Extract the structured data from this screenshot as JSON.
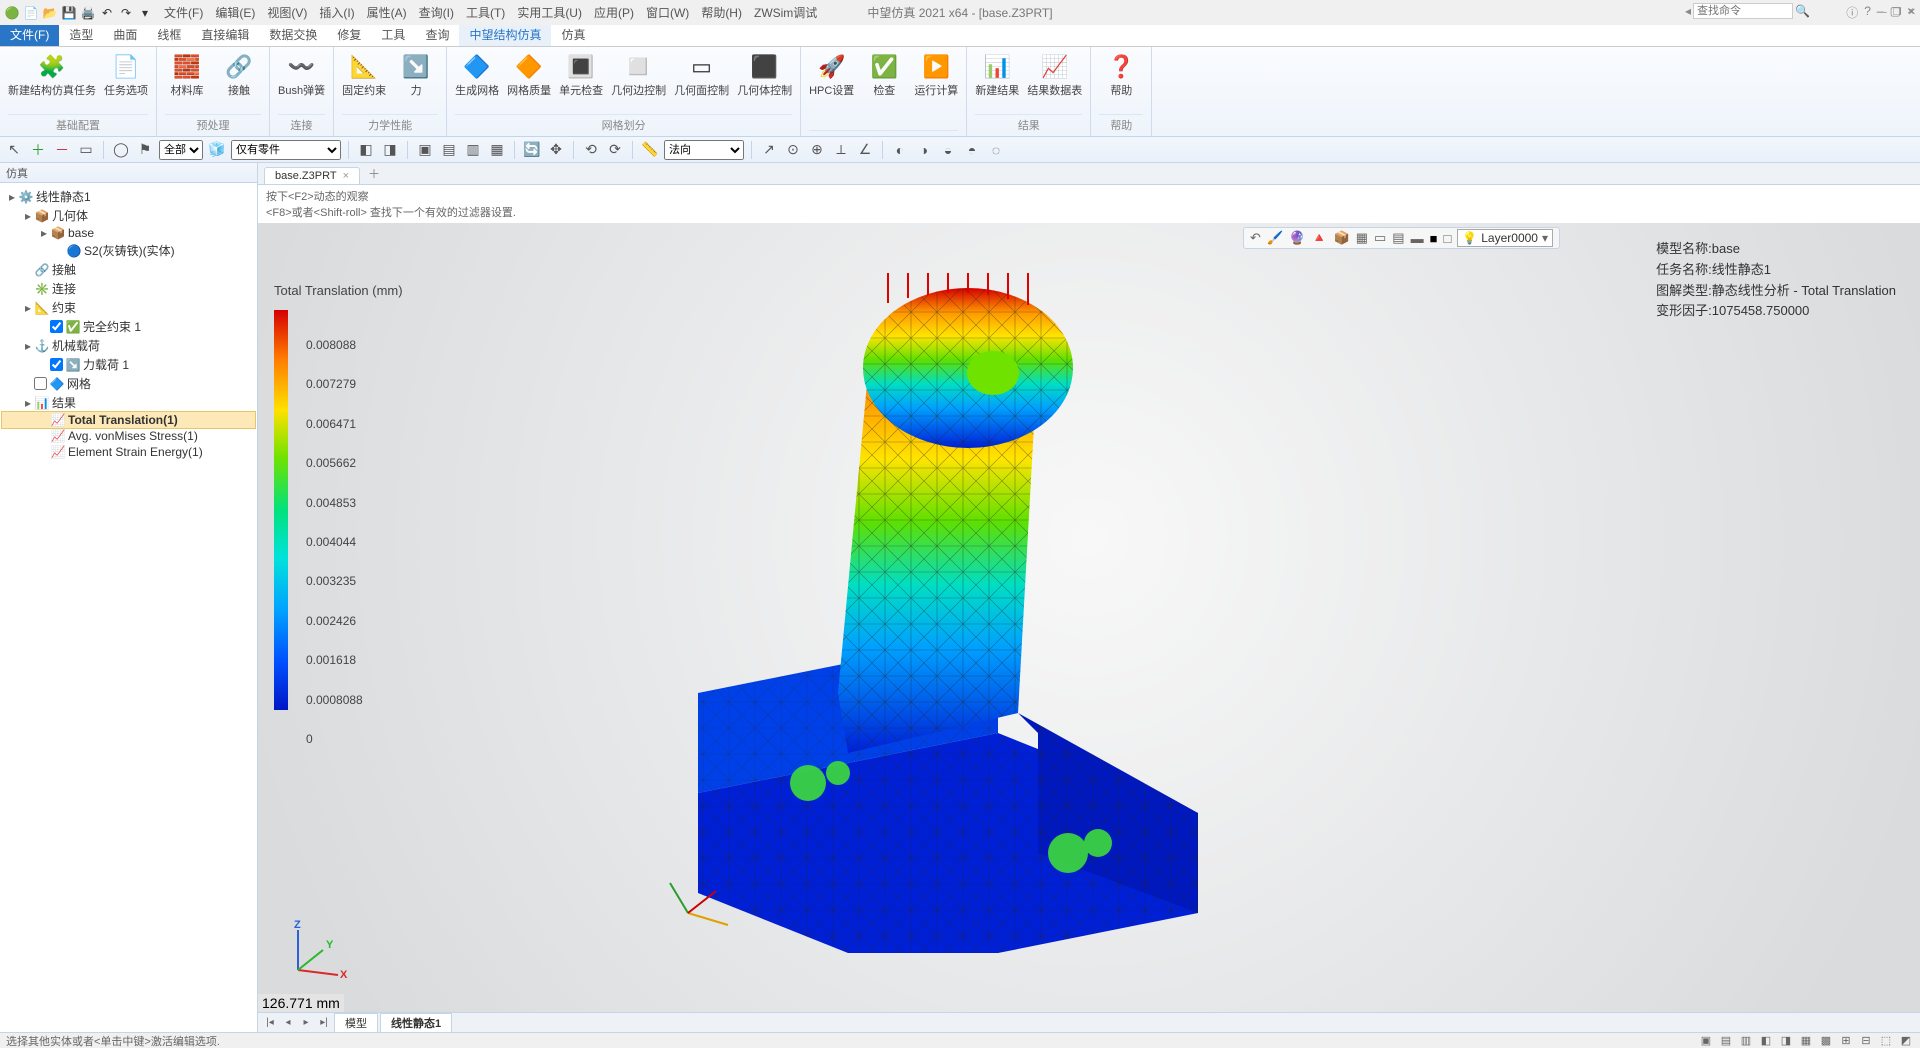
{
  "app": {
    "title": "中望仿真 2021 x64 - [base.Z3PRT]"
  },
  "menus": [
    "文件(F)",
    "编辑(E)",
    "视图(V)",
    "插入(I)",
    "属性(A)",
    "查询(I)",
    "工具(T)",
    "实用工具(U)",
    "应用(P)",
    "窗口(W)",
    "帮助(H)",
    "ZWSim调试"
  ],
  "ribbon_tabs": {
    "file": "文件(F)",
    "items": [
      "造型",
      "曲面",
      "线框",
      "直接编辑",
      "数据交换",
      "修复",
      "工具",
      "查询",
      "中望结构仿真",
      "仿真"
    ],
    "active_index": 8
  },
  "ribbon_groups": [
    {
      "label": "基础配置",
      "buttons": [
        {
          "label": "新建结构仿真任务",
          "icon": "🧩"
        },
        {
          "label": "任务选项",
          "icon": "📄"
        }
      ]
    },
    {
      "label": "预处理",
      "buttons": [
        {
          "label": "材料库",
          "icon": "🧱"
        },
        {
          "label": "接触",
          "icon": "🔗"
        }
      ]
    },
    {
      "label": "连接",
      "buttons": [
        {
          "label": "Bush弹簧",
          "icon": "〰️"
        }
      ]
    },
    {
      "label": "力学性能",
      "buttons": [
        {
          "label": "固定约束",
          "icon": "📐"
        },
        {
          "label": "力",
          "icon": "↘️"
        }
      ]
    },
    {
      "label": "网格划分",
      "buttons": [
        {
          "label": "生成网格",
          "icon": "🔷"
        },
        {
          "label": "网格质量",
          "icon": "🔶"
        },
        {
          "label": "单元检查",
          "icon": "🔳"
        },
        {
          "label": "几何边控制",
          "icon": "◻️"
        },
        {
          "label": "几何面控制",
          "icon": "▭"
        },
        {
          "label": "几何体控制",
          "icon": "⬛"
        }
      ]
    },
    {
      "label": "",
      "buttons": [
        {
          "label": "HPC设置",
          "icon": "🚀"
        },
        {
          "label": "检查",
          "icon": "✅"
        },
        {
          "label": "运行计算",
          "icon": "▶️"
        }
      ]
    },
    {
      "label": "结果",
      "buttons": [
        {
          "label": "新建结果",
          "icon": "📊"
        },
        {
          "label": "结果数据表",
          "icon": "📈"
        }
      ]
    },
    {
      "label": "帮助",
      "buttons": [
        {
          "label": "帮助",
          "icon": "❓"
        }
      ]
    }
  ],
  "toolbar": {
    "dropdown_all": "全部",
    "filter": "仅有零件",
    "direction": "法向"
  },
  "search": {
    "placeholder": "查找命令"
  },
  "side_panel": {
    "title": "仿真",
    "tree": [
      {
        "depth": 0,
        "tw": "▸",
        "icon": "⚙️",
        "label": "线性静态1",
        "cls": ""
      },
      {
        "depth": 1,
        "tw": "▸",
        "icon": "📦",
        "label": "几何体"
      },
      {
        "depth": 2,
        "tw": "▸",
        "icon": "📦",
        "label": "base"
      },
      {
        "depth": 3,
        "tw": "",
        "icon": "🔵",
        "label": "S2(灰铸铁)(实体)"
      },
      {
        "depth": 1,
        "tw": "",
        "icon": "🔗",
        "label": "接触"
      },
      {
        "depth": 1,
        "tw": "",
        "icon": "✳️",
        "label": "连接"
      },
      {
        "depth": 1,
        "tw": "▸",
        "icon": "📐",
        "label": "约束"
      },
      {
        "depth": 2,
        "tw": "",
        "icon": "✅",
        "label": "完全约束 1",
        "checkbox": true
      },
      {
        "depth": 1,
        "tw": "▸",
        "icon": "⚓",
        "label": "机械载荷"
      },
      {
        "depth": 2,
        "tw": "",
        "icon": "↘️",
        "label": "力载荷 1",
        "checkbox": true
      },
      {
        "depth": 1,
        "tw": "",
        "icon": "🔷",
        "label": "网格",
        "checkbox": false,
        "unchecked": true
      },
      {
        "depth": 1,
        "tw": "▸",
        "icon": "📊",
        "label": "结果"
      },
      {
        "depth": 2,
        "tw": "",
        "icon": "📈",
        "label": "Total Translation(1)",
        "bold": true,
        "sel": true
      },
      {
        "depth": 2,
        "tw": "",
        "icon": "📈",
        "label": "Avg. vonMises Stress(1)"
      },
      {
        "depth": 2,
        "tw": "",
        "icon": "📈",
        "label": "Element Strain Energy(1)"
      }
    ]
  },
  "doc_tab": {
    "name": "base.Z3PRT",
    "closable": true
  },
  "hint_lines": [
    "按下<F2>动态的观察",
    "<F8>或者<Shift-roll> 查找下一个有效的过滤器设置."
  ],
  "legend": {
    "title": "Total Translation (mm)",
    "ticks": [
      "0.008088",
      "0.007279",
      "0.006471",
      "0.005662",
      "0.004853",
      "0.004044",
      "0.003235",
      "0.002426",
      "0.001618",
      "0.0008088",
      "0"
    ]
  },
  "info": {
    "l1": "模型名称:base",
    "l2": "任务名称:线性静态1",
    "l3": "图解类型:静态线性分析 - Total Translation",
    "l4": "变形因子:1075458.750000"
  },
  "scale_readout": "126.771 mm",
  "bottom_tabs": [
    "模型",
    "线性静态1"
  ],
  "status_text": "选择其他实体或者<单击中键>激活编辑选项.",
  "layer": "Layer0000"
}
